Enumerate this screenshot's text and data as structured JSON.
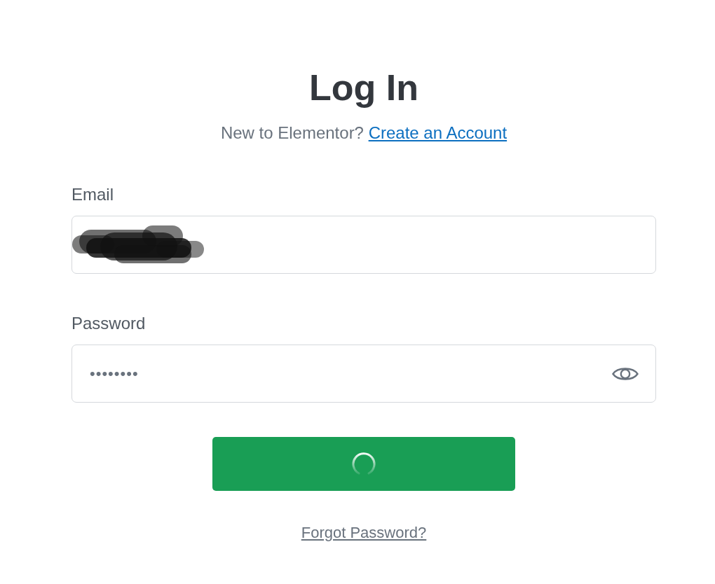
{
  "title": "Log In",
  "signup_prompt": {
    "text": "New to Elementor?",
    "link": "Create an Account"
  },
  "email_field": {
    "label": "Email",
    "redacted": true
  },
  "password_field": {
    "label": "Password",
    "value": "••••••••"
  },
  "login_button": {
    "loading": true
  },
  "forgot_password_link": "Forgot Password?"
}
